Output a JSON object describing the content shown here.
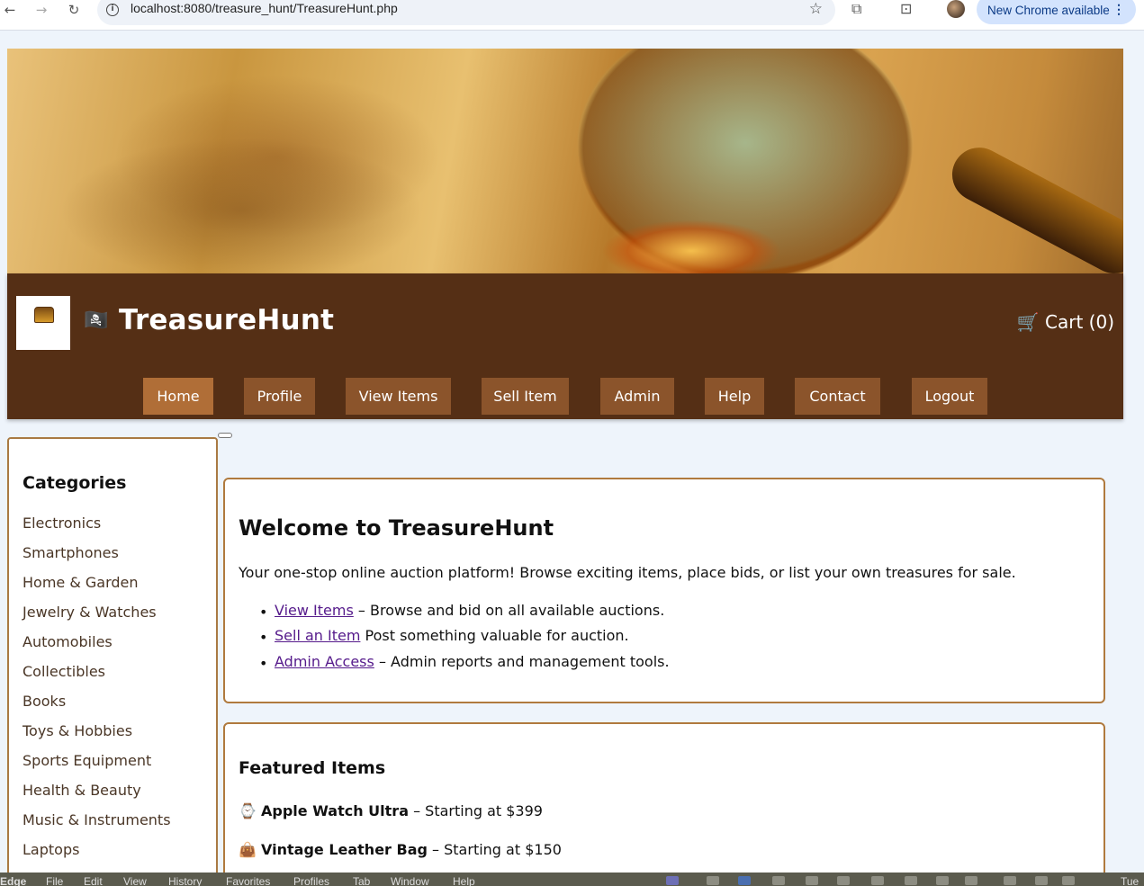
{
  "browser": {
    "url": "localhost:8080/treasure_hunt/TreasureHunt.php",
    "new_chrome": "New Chrome available"
  },
  "header": {
    "brand_flag": "🏴‍☠️",
    "brand_name": "TreasureHunt",
    "cart_label": "🛒 Cart (0)",
    "nav": [
      {
        "label": "Home",
        "active": true
      },
      {
        "label": "Profile"
      },
      {
        "label": "View Items"
      },
      {
        "label": "Sell Item"
      },
      {
        "label": "Admin"
      },
      {
        "label": "Help"
      },
      {
        "label": "Contact"
      },
      {
        "label": "Logout"
      }
    ]
  },
  "sidebar": {
    "title": "Categories",
    "categories": [
      "Electronics",
      "Smartphones",
      "Home & Garden",
      "Jewelry & Watches",
      "Automobiles",
      "Collectibles",
      "Books",
      "Toys & Hobbies",
      "Sports Equipment",
      "Health & Beauty",
      "Music & Instruments",
      "Laptops"
    ]
  },
  "welcome": {
    "title": "Welcome to TreasureHunt",
    "intro": "Your one-stop online auction platform! Browse exciting items, place bids, or list your own treasures for sale.",
    "links": [
      {
        "link": "View Items",
        "text": " – Browse and bid on all available auctions."
      },
      {
        "link": "Sell an Item",
        "text": " Post something valuable for auction."
      },
      {
        "link": "Admin Access",
        "text": " – Admin reports and management tools."
      }
    ]
  },
  "featured": {
    "title": "Featured Items",
    "items": [
      {
        "icon": "⌚",
        "name": "Apple Watch Ultra",
        "text": " – Starting at $399"
      },
      {
        "icon": "👜",
        "name": "Vintage Leather Bag",
        "text": " – Starting at $150"
      }
    ]
  },
  "os_menu": [
    "Edge",
    "File",
    "Edit",
    "View",
    "History",
    "Favorites",
    "Profiles",
    "Tab",
    "Window",
    "Help"
  ],
  "os_clock": "Tue"
}
